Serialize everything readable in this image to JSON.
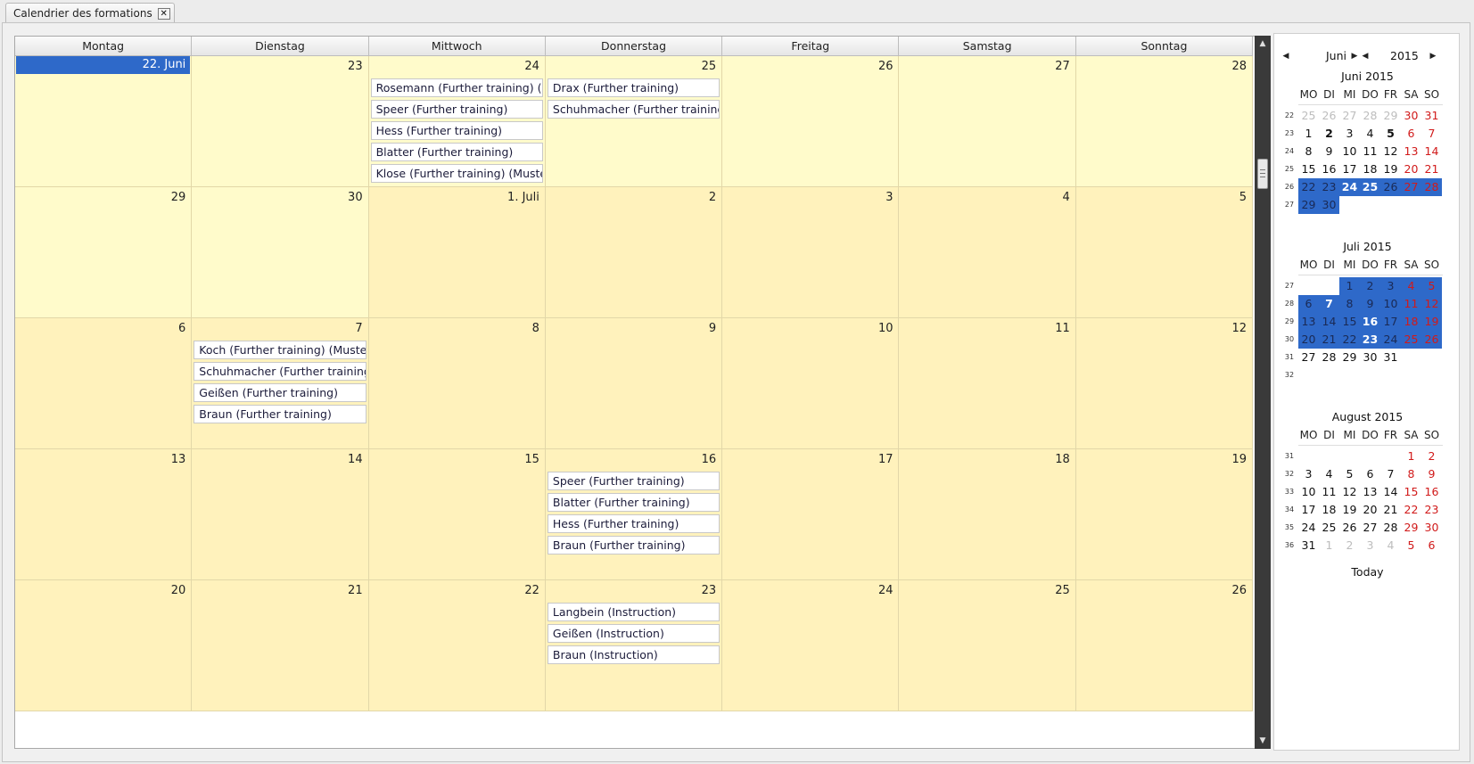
{
  "tab": {
    "title": "Calendrier des formations",
    "close": "✕"
  },
  "weekdays": [
    "Montag",
    "Dienstag",
    "Mittwoch",
    "Donnerstag",
    "Freitag",
    "Samstag",
    "Sonntag"
  ],
  "weeks": [
    [
      {
        "label": "22. Juni",
        "today": true,
        "month": "cur",
        "events": []
      },
      {
        "label": "23",
        "month": "cur",
        "events": []
      },
      {
        "label": "24",
        "month": "cur",
        "events": [
          "Rosemann (Further training) (Mu",
          "Speer (Further training)",
          "Hess (Further training)",
          "Blatter (Further training)",
          "Klose (Further training) (Musters"
        ]
      },
      {
        "label": "25",
        "month": "cur",
        "events": [
          "Drax (Further training)",
          "Schuhmacher (Further training)"
        ]
      },
      {
        "label": "26",
        "month": "cur",
        "events": []
      },
      {
        "label": "27",
        "month": "cur",
        "events": []
      },
      {
        "label": "28",
        "month": "cur",
        "events": []
      }
    ],
    [
      {
        "label": "29",
        "month": "cur",
        "events": []
      },
      {
        "label": "30",
        "month": "cur",
        "events": []
      },
      {
        "label": "1. Juli",
        "month": "next",
        "events": []
      },
      {
        "label": "2",
        "month": "next",
        "events": []
      },
      {
        "label": "3",
        "month": "next",
        "events": []
      },
      {
        "label": "4",
        "month": "next",
        "events": []
      },
      {
        "label": "5",
        "month": "next",
        "events": []
      }
    ],
    [
      {
        "label": "6",
        "month": "next",
        "events": []
      },
      {
        "label": "7",
        "month": "next",
        "events": [
          "Koch (Further training) (Musters",
          "Schuhmacher (Further training)",
          "Geißen (Further training)",
          "Braun (Further training)"
        ]
      },
      {
        "label": "8",
        "month": "next",
        "events": []
      },
      {
        "label": "9",
        "month": "next",
        "events": []
      },
      {
        "label": "10",
        "month": "next",
        "events": []
      },
      {
        "label": "11",
        "month": "next",
        "events": []
      },
      {
        "label": "12",
        "month": "next",
        "events": []
      }
    ],
    [
      {
        "label": "13",
        "month": "next",
        "events": []
      },
      {
        "label": "14",
        "month": "next",
        "events": []
      },
      {
        "label": "15",
        "month": "next",
        "events": []
      },
      {
        "label": "16",
        "month": "next",
        "events": [
          "Speer (Further training)",
          "Blatter (Further training)",
          "Hess (Further training)",
          "Braun (Further training)"
        ]
      },
      {
        "label": "17",
        "month": "next",
        "events": []
      },
      {
        "label": "18",
        "month": "next",
        "events": []
      },
      {
        "label": "19",
        "month": "next",
        "events": []
      }
    ],
    [
      {
        "label": "20",
        "month": "next",
        "events": []
      },
      {
        "label": "21",
        "month": "next",
        "events": []
      },
      {
        "label": "22",
        "month": "next",
        "events": []
      },
      {
        "label": "23",
        "month": "next",
        "events": [
          "Langbein (Instruction)",
          "Geißen (Instruction)",
          "Braun (Instruction)"
        ]
      },
      {
        "label": "24",
        "month": "next",
        "events": []
      },
      {
        "label": "25",
        "month": "next",
        "events": []
      },
      {
        "label": "26",
        "month": "next",
        "events": []
      }
    ]
  ],
  "mini": {
    "nav_month": "Juni",
    "nav_year": "2015",
    "dow": [
      "MO",
      "DI",
      "MI",
      "DO",
      "FR",
      "SA",
      "SO"
    ],
    "today_label": "Today",
    "accent": "#2e69c9",
    "weekend_color": "#d11a1a",
    "months": [
      {
        "title": "Juni 2015",
        "rows": [
          {
            "wk": "22",
            "days": [
              {
                "d": "25",
                "o": 1
              },
              {
                "d": "26",
                "o": 1
              },
              {
                "d": "27",
                "o": 1
              },
              {
                "d": "28",
                "o": 1
              },
              {
                "d": "29",
                "o": 1
              },
              {
                "d": "30",
                "w": 1
              },
              {
                "d": "31",
                "w": 1
              }
            ]
          },
          {
            "wk": "23",
            "days": [
              {
                "d": "1"
              },
              {
                "d": "2",
                "b": 1
              },
              {
                "d": "3"
              },
              {
                "d": "4"
              },
              {
                "d": "5",
                "b": 1
              },
              {
                "d": "6",
                "w": 1
              },
              {
                "d": "7",
                "w": 1
              }
            ]
          },
          {
            "wk": "24",
            "days": [
              {
                "d": "8"
              },
              {
                "d": "9"
              },
              {
                "d": "10"
              },
              {
                "d": "11"
              },
              {
                "d": "12"
              },
              {
                "d": "13",
                "w": 1
              },
              {
                "d": "14",
                "w": 1
              }
            ]
          },
          {
            "wk": "25",
            "days": [
              {
                "d": "15"
              },
              {
                "d": "16"
              },
              {
                "d": "17"
              },
              {
                "d": "18"
              },
              {
                "d": "19"
              },
              {
                "d": "20",
                "w": 1
              },
              {
                "d": "21",
                "w": 1
              }
            ]
          },
          {
            "wk": "26",
            "days": [
              {
                "d": "22",
                "s": 1
              },
              {
                "d": "23",
                "s": 1
              },
              {
                "d": "24",
                "s": 1,
                "b": 1
              },
              {
                "d": "25",
                "s": 1,
                "b": 1
              },
              {
                "d": "26",
                "s": 1
              },
              {
                "d": "27",
                "s": 1,
                "w": 1
              },
              {
                "d": "28",
                "s": 1,
                "w": 1
              }
            ]
          },
          {
            "wk": "27",
            "days": [
              {
                "d": "29",
                "s": 1
              },
              {
                "d": "30",
                "s": 1
              },
              {
                "d": ""
              },
              {
                "d": ""
              },
              {
                "d": ""
              },
              {
                "d": ""
              },
              {
                "d": ""
              }
            ]
          }
        ]
      },
      {
        "title": "Juli 2015",
        "rows": [
          {
            "wk": "27",
            "days": [
              {
                "d": ""
              },
              {
                "d": ""
              },
              {
                "d": "1",
                "s": 1
              },
              {
                "d": "2",
                "s": 1
              },
              {
                "d": "3",
                "s": 1
              },
              {
                "d": "4",
                "s": 1,
                "w": 1
              },
              {
                "d": "5",
                "s": 1,
                "w": 1
              }
            ]
          },
          {
            "wk": "28",
            "days": [
              {
                "d": "6",
                "s": 1
              },
              {
                "d": "7",
                "s": 1,
                "b": 1
              },
              {
                "d": "8",
                "s": 1
              },
              {
                "d": "9",
                "s": 1
              },
              {
                "d": "10",
                "s": 1
              },
              {
                "d": "11",
                "s": 1,
                "w": 1
              },
              {
                "d": "12",
                "s": 1,
                "w": 1
              }
            ]
          },
          {
            "wk": "29",
            "days": [
              {
                "d": "13",
                "s": 1
              },
              {
                "d": "14",
                "s": 1
              },
              {
                "d": "15",
                "s": 1
              },
              {
                "d": "16",
                "s": 1,
                "b": 1
              },
              {
                "d": "17",
                "s": 1
              },
              {
                "d": "18",
                "s": 1,
                "w": 1
              },
              {
                "d": "19",
                "s": 1,
                "w": 1
              }
            ]
          },
          {
            "wk": "30",
            "days": [
              {
                "d": "20",
                "s": 1
              },
              {
                "d": "21",
                "s": 1
              },
              {
                "d": "22",
                "s": 1
              },
              {
                "d": "23",
                "s": 1,
                "b": 1
              },
              {
                "d": "24",
                "s": 1
              },
              {
                "d": "25",
                "s": 1,
                "w": 1
              },
              {
                "d": "26",
                "s": 1,
                "w": 1
              }
            ]
          },
          {
            "wk": "31",
            "days": [
              {
                "d": "27"
              },
              {
                "d": "28"
              },
              {
                "d": "29"
              },
              {
                "d": "30"
              },
              {
                "d": "31"
              },
              {
                "d": ""
              },
              {
                "d": ""
              }
            ]
          },
          {
            "wk": "32",
            "days": [
              {
                "d": ""
              },
              {
                "d": ""
              },
              {
                "d": ""
              },
              {
                "d": ""
              },
              {
                "d": ""
              },
              {
                "d": ""
              },
              {
                "d": ""
              }
            ]
          }
        ]
      },
      {
        "title": "August 2015",
        "rows": [
          {
            "wk": "31",
            "days": [
              {
                "d": ""
              },
              {
                "d": ""
              },
              {
                "d": ""
              },
              {
                "d": ""
              },
              {
                "d": ""
              },
              {
                "d": "1",
                "w": 1
              },
              {
                "d": "2",
                "w": 1
              }
            ]
          },
          {
            "wk": "32",
            "days": [
              {
                "d": "3"
              },
              {
                "d": "4"
              },
              {
                "d": "5"
              },
              {
                "d": "6"
              },
              {
                "d": "7"
              },
              {
                "d": "8",
                "w": 1
              },
              {
                "d": "9",
                "w": 1
              }
            ]
          },
          {
            "wk": "33",
            "days": [
              {
                "d": "10"
              },
              {
                "d": "11"
              },
              {
                "d": "12"
              },
              {
                "d": "13"
              },
              {
                "d": "14"
              },
              {
                "d": "15",
                "w": 1
              },
              {
                "d": "16",
                "w": 1
              }
            ]
          },
          {
            "wk": "34",
            "days": [
              {
                "d": "17"
              },
              {
                "d": "18"
              },
              {
                "d": "19"
              },
              {
                "d": "20"
              },
              {
                "d": "21"
              },
              {
                "d": "22",
                "w": 1
              },
              {
                "d": "23",
                "w": 1
              }
            ]
          },
          {
            "wk": "35",
            "days": [
              {
                "d": "24"
              },
              {
                "d": "25"
              },
              {
                "d": "26"
              },
              {
                "d": "27"
              },
              {
                "d": "28"
              },
              {
                "d": "29",
                "w": 1
              },
              {
                "d": "30",
                "w": 1
              }
            ]
          },
          {
            "wk": "36",
            "days": [
              {
                "d": "31"
              },
              {
                "d": "1",
                "o": 1
              },
              {
                "d": "2",
                "o": 1
              },
              {
                "d": "3",
                "o": 1
              },
              {
                "d": "4",
                "o": 1
              },
              {
                "d": "5",
                "w": 1
              },
              {
                "d": "6",
                "w": 1
              }
            ]
          }
        ]
      }
    ]
  }
}
